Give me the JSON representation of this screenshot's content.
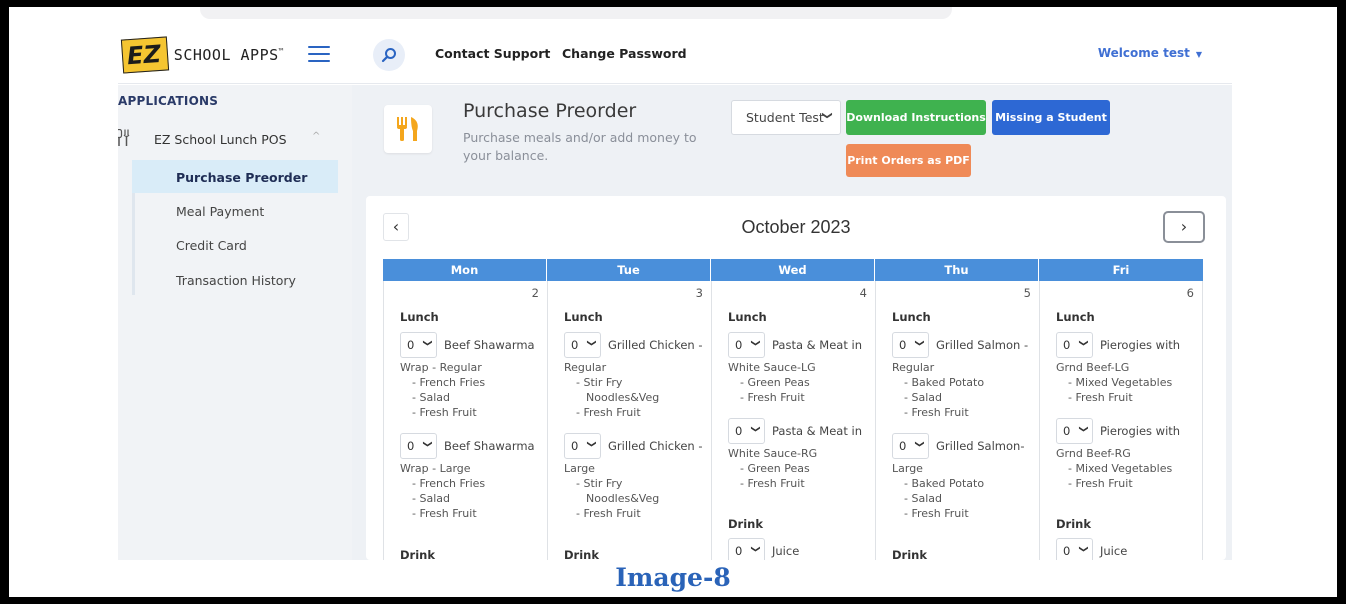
{
  "header": {
    "logo_badge": "EZ",
    "logo_text": "SCHOOL APPS",
    "logo_mark": "™",
    "contact_support": "Contact Support",
    "change_password": "Change Password",
    "welcome": "Welcome test",
    "welcome_caret": "▼"
  },
  "sidebar": {
    "section": "APPLICATIONS",
    "app": "EZ School Lunch POS",
    "app_chevron": "^",
    "items": [
      {
        "label": "Purchase Preorder",
        "active": true
      },
      {
        "label": "Meal Payment",
        "active": false
      },
      {
        "label": "Credit Card",
        "active": false
      },
      {
        "label": "Transaction History",
        "active": false
      }
    ]
  },
  "page": {
    "title": "Purchase Preorder",
    "subtitle": "Purchase meals and/or add money to your balance.",
    "student_select": "Student Test",
    "download_instructions": "Download Instructions",
    "missing_student": "Missing a Student",
    "print_orders": "Print Orders as PDF"
  },
  "calendar": {
    "month": "October 2023",
    "prev": "‹",
    "next": "›",
    "weekdays": [
      "Mon",
      "Tue",
      "Wed",
      "Thu",
      "Fri"
    ],
    "days": [
      {
        "num": "2",
        "lunch_label": "Lunch",
        "lunch": [
          {
            "qty": "0",
            "first": "Beef Shawarma",
            "second": "Wrap - Regular",
            "sides": [
              "- French Fries",
              "- Salad",
              "- Fresh Fruit"
            ]
          },
          {
            "qty": "0",
            "first": "Beef Shawarma",
            "second": "Wrap - Large",
            "sides": [
              "- French Fries",
              "- Salad",
              "- Fresh Fruit"
            ]
          }
        ],
        "drink_label": "Drink",
        "drinks": []
      },
      {
        "num": "3",
        "lunch_label": "Lunch",
        "lunch": [
          {
            "qty": "0",
            "first": "Grilled Chicken -",
            "second": "Regular",
            "sides": [
              "- Stir Fry",
              "Noodles&Veg",
              "- Fresh Fruit"
            ]
          },
          {
            "qty": "0",
            "first": "Grilled Chicken -",
            "second": "Large",
            "sides": [
              "- Stir Fry",
              "Noodles&Veg",
              "- Fresh Fruit"
            ]
          }
        ],
        "drink_label": "Drink",
        "drinks": []
      },
      {
        "num": "4",
        "lunch_label": "Lunch",
        "lunch": [
          {
            "qty": "0",
            "first": "Pasta & Meat in",
            "second": "White Sauce-LG",
            "sides": [
              "- Green Peas",
              "- Fresh Fruit"
            ]
          },
          {
            "qty": "0",
            "first": "Pasta & Meat in",
            "second": "White Sauce-RG",
            "sides": [
              "- Green Peas",
              "- Fresh Fruit"
            ]
          }
        ],
        "drink_label": "Drink",
        "drinks": [
          {
            "qty": "0",
            "name": "Juice"
          }
        ]
      },
      {
        "num": "5",
        "lunch_label": "Lunch",
        "lunch": [
          {
            "qty": "0",
            "first": "Grilled Salmon -",
            "second": "Regular",
            "sides": [
              "- Baked Potato",
              "- Salad",
              "- Fresh Fruit"
            ]
          },
          {
            "qty": "0",
            "first": "Grilled Salmon-",
            "second": "Large",
            "sides": [
              "- Baked Potato",
              "- Salad",
              "- Fresh Fruit"
            ]
          }
        ],
        "drink_label": "Drink",
        "drinks": []
      },
      {
        "num": "6",
        "lunch_label": "Lunch",
        "lunch": [
          {
            "qty": "0",
            "first": "Pierogies with",
            "second": "Grnd Beef-LG",
            "sides": [
              "- Mixed Vegetables",
              "- Fresh Fruit"
            ]
          },
          {
            "qty": "0",
            "first": "Pierogies with",
            "second": "Grnd Beef-RG",
            "sides": [
              "- Mixed Vegetables",
              "- Fresh Fruit"
            ]
          }
        ],
        "drink_label": "Drink",
        "drinks": [
          {
            "qty": "0",
            "name": "Juice"
          }
        ]
      }
    ]
  },
  "caption": "Image-8",
  "colors": {
    "accent_blue": "#2d68d4",
    "header_blue": "#4a8fda",
    "green": "#3fb24f",
    "orange": "#ef8a57",
    "active_bg": "#d9ecf8",
    "caption": "#2a63b8"
  }
}
